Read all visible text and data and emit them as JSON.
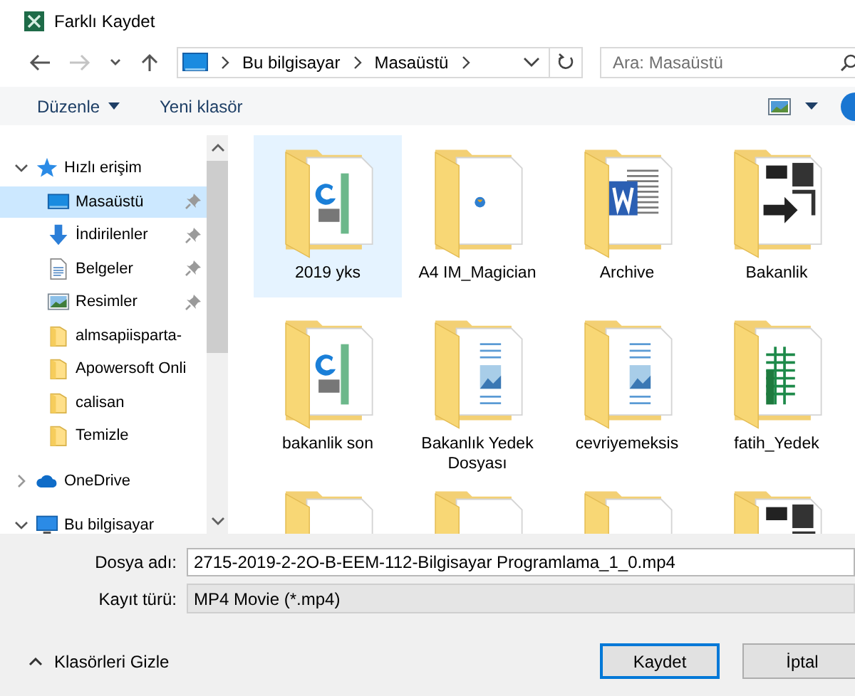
{
  "window": {
    "title": "Farklı Kaydet"
  },
  "navigation": [
    {
      "kind": "back",
      "disabled": false
    },
    {
      "kind": "forward",
      "disabled": true
    },
    {
      "kind": "recent",
      "disabled": false
    },
    {
      "kind": "up",
      "disabled": false
    }
  ],
  "address": {
    "path": [
      "Bu bilgisayar",
      "Masaüstü"
    ]
  },
  "search": {
    "placeholder": "Ara: Masaüstü"
  },
  "toolbar": {
    "organize": "Düzenle",
    "new_folder": "Yeni klasör"
  },
  "sidebar": {
    "items": [
      {
        "label": "Hızlı erişim",
        "kind": "star",
        "expanded": true,
        "selected": false,
        "children": [
          {
            "label": "Masaüstü",
            "kind": "desktop",
            "pinned": true,
            "selected": true
          },
          {
            "label": "İndirilenler",
            "kind": "download",
            "pinned": true,
            "selected": false
          },
          {
            "label": "Belgeler",
            "kind": "document",
            "pinned": true,
            "selected": false
          },
          {
            "label": "Resimler",
            "kind": "pictures",
            "pinned": true,
            "selected": false
          },
          {
            "label": "almsapiisparta-",
            "kind": "folder",
            "pinned": false,
            "selected": false
          },
          {
            "label": "Apowersoft Onli",
            "kind": "folder",
            "pinned": false,
            "selected": false
          },
          {
            "label": "calisan",
            "kind": "folder",
            "pinned": false,
            "selected": false
          },
          {
            "label": "Temizle",
            "kind": "folder",
            "pinned": false,
            "selected": false
          }
        ]
      },
      {
        "label": "OneDrive",
        "kind": "cloud",
        "expanded": false,
        "selected": false
      },
      {
        "label": "Bu bilgisayar",
        "kind": "computer",
        "expanded": true,
        "selected": false
      }
    ]
  },
  "files": [
    {
      "name": "2019 yks",
      "kind": "pdf",
      "selected": true
    },
    {
      "name": "A4 IM_Magician",
      "kind": "web",
      "selected": false
    },
    {
      "name": "Archive",
      "kind": "word",
      "selected": false
    },
    {
      "name": "Bakanlik",
      "kind": "sign",
      "selected": false
    },
    {
      "name": "bakanlik son",
      "kind": "pdf",
      "selected": false
    },
    {
      "name": "Bakanlık Yedek Dosyası",
      "kind": "doc",
      "selected": false
    },
    {
      "name": "cevriyemeksis",
      "kind": "doc",
      "selected": false
    },
    {
      "name": "fatih_Yedek",
      "kind": "excel",
      "selected": false
    },
    {
      "kind": "plain",
      "selected": false
    },
    {
      "kind": "plain",
      "selected": false
    },
    {
      "kind": "plain",
      "selected": false
    },
    {
      "kind": "sign",
      "selected": false
    }
  ],
  "form": {
    "file_name": {
      "label": "Dosya adı:",
      "value": "2715-2019-2-2O-B-EEM-112-Bilgisayar Programlama_1_0.mp4"
    },
    "file_type": {
      "label": "Kayıt türü:",
      "value": "MP4 Movie (*.mp4)"
    }
  },
  "footer": {
    "hide_folders": "Klasörleri Gizle",
    "buttons": [
      {
        "label": "Kaydet",
        "default": true
      },
      {
        "label": "İptal",
        "default": false
      }
    ]
  }
}
